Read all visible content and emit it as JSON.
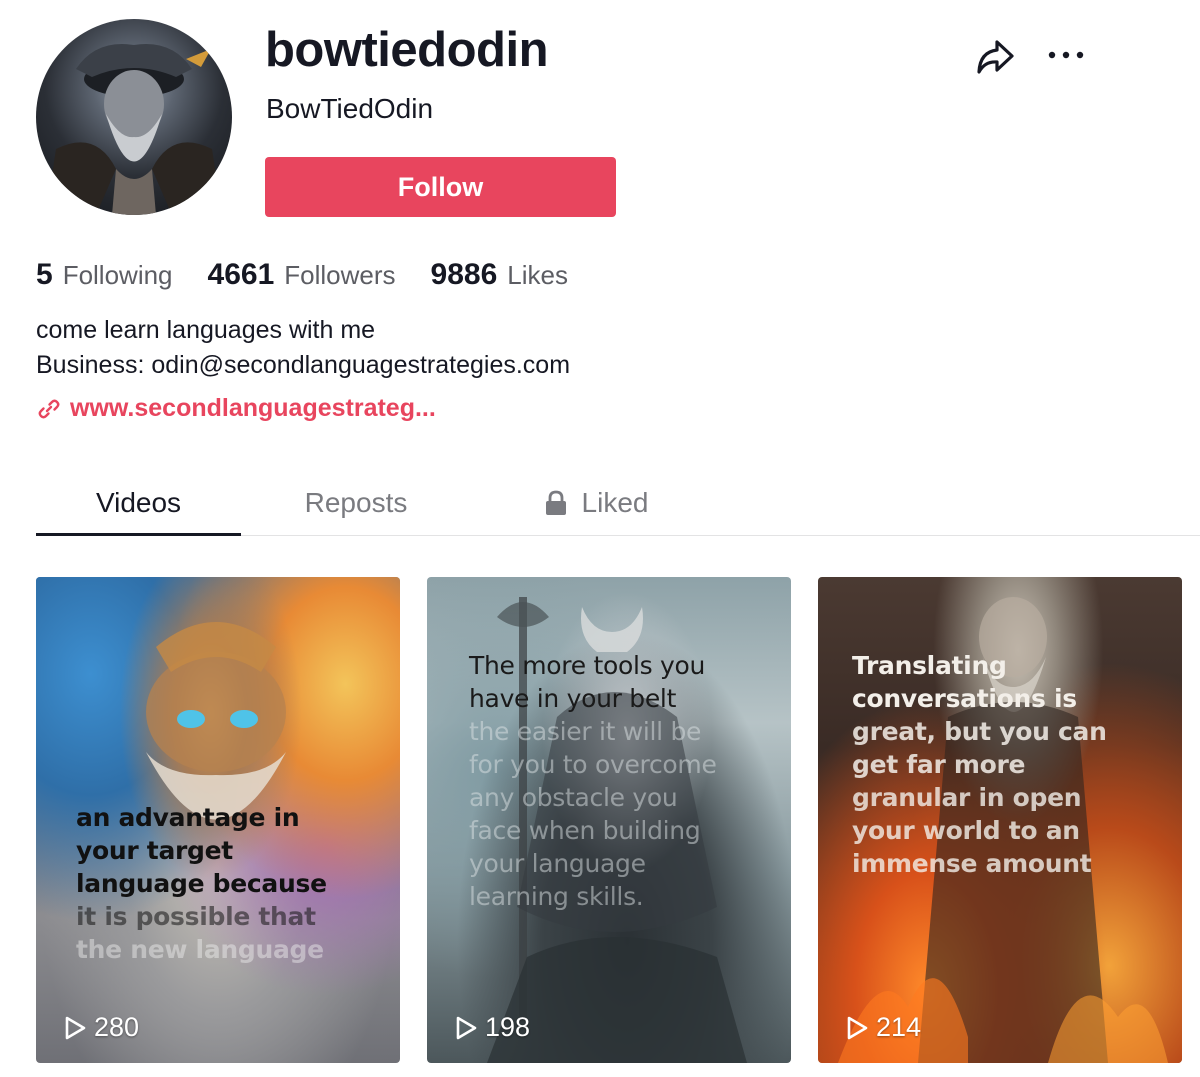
{
  "profile": {
    "username": "bowtiedodin",
    "nickname": "BowTiedOdin",
    "follow_label": "Follow",
    "bio_line1": "come learn languages with me",
    "bio_line2": "Business: odin@secondlanguagestrategies.com",
    "link_text": "www.secondlanguagestrateg..."
  },
  "stats": [
    {
      "value": "5",
      "label": "Following"
    },
    {
      "value": "4661",
      "label": "Followers"
    },
    {
      "value": "9886",
      "label": "Likes"
    }
  ],
  "tabs": [
    {
      "label": "Videos",
      "active": true
    },
    {
      "label": "Reposts",
      "active": false
    },
    {
      "label": "Liked",
      "active": false,
      "icon": "lock-icon"
    }
  ],
  "videos": [
    {
      "caption_lines": [
        "an advantage in",
        "your target",
        "language because",
        "it is possible that",
        "the new language"
      ],
      "views": "280"
    },
    {
      "caption_lines": [
        "The more tools you",
        "have in your belt",
        "the easier it will be",
        "for you to overcome",
        "any obstacle you",
        "face when building",
        "your language",
        "learning skills."
      ],
      "views": "198"
    },
    {
      "caption_lines": [
        "Translating",
        "conversations is",
        "great, but you can",
        "get far more",
        "granular in open",
        "your world to an",
        "immense amount"
      ],
      "views": "214"
    }
  ],
  "colors": {
    "accent": "#e8455e",
    "text_primary": "#161823",
    "text_secondary": "#5c5d63"
  },
  "icons": {
    "share": "share-icon",
    "more": "more-icon",
    "link": "link-icon",
    "play": "play-icon"
  }
}
